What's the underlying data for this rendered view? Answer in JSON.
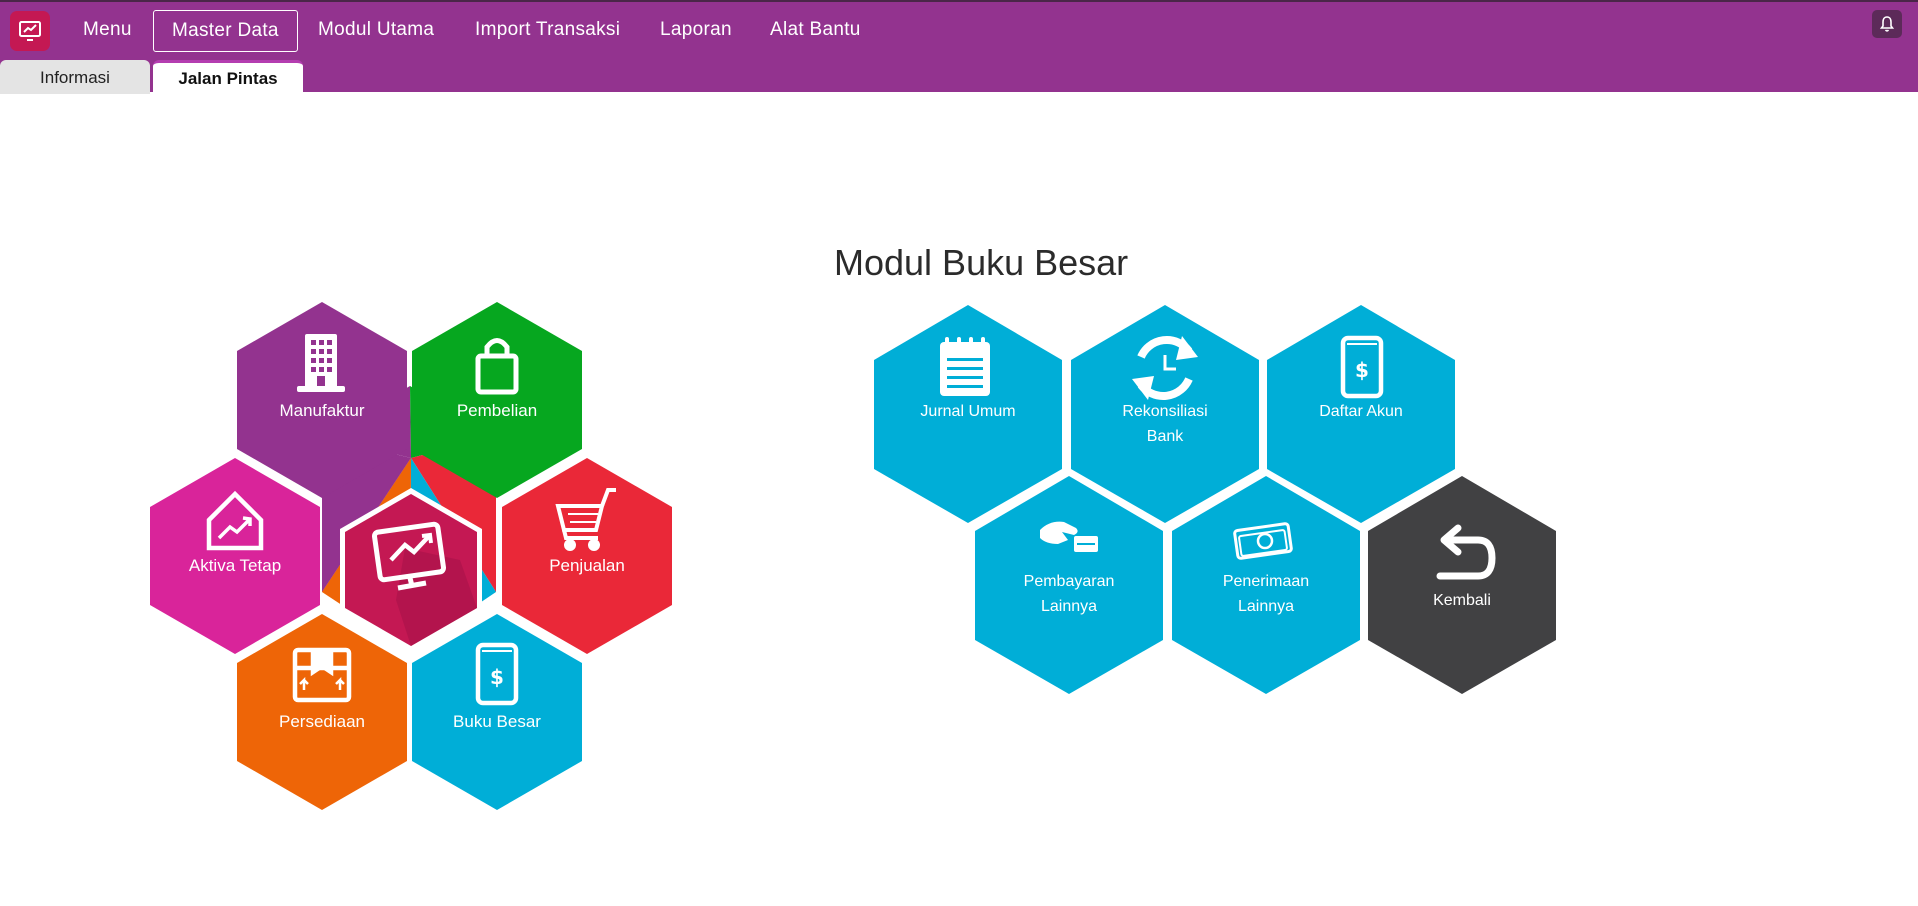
{
  "nav": {
    "items": [
      "Menu",
      "Master Data",
      "Modul Utama",
      "Import Transaksi",
      "Laporan",
      "Alat Bantu"
    ],
    "active": "Master Data"
  },
  "tabs": [
    "Informasi",
    "Jalan Pintas"
  ],
  "active_tab": "Jalan Pintas",
  "page_title": "Modul Buku Besar",
  "left_modules": {
    "manufaktur": {
      "label": "Manufaktur",
      "color": "#93338f",
      "icon": "building-icon"
    },
    "pembelian": {
      "label": "Pembelian",
      "color": "#06a71f",
      "icon": "shopping-bag-icon"
    },
    "aktiva": {
      "label": "Aktiva Tetap",
      "color": "#d9249a",
      "icon": "house-chart-icon"
    },
    "penjualan": {
      "label": "Penjualan",
      "color": "#ea2838",
      "icon": "cart-icon"
    },
    "persediaan": {
      "label": "Persediaan",
      "color": "#ee6507",
      "icon": "box-icon"
    },
    "buku_besar": {
      "label": "Buku Besar",
      "color": "#00aed7",
      "icon": "dollar-book-icon"
    },
    "center": {
      "color": "#c41853",
      "icon": "monitor-chart-icon"
    }
  },
  "right_modules": {
    "jurnal": {
      "label": "Jurnal Umum",
      "color": "#00aed7",
      "icon": "notepad-icon"
    },
    "rekon": {
      "label": "Rekonsiliasi",
      "label2": "Bank",
      "color": "#00aed7",
      "icon": "sync-clock-icon"
    },
    "daftar": {
      "label": "Daftar Akun",
      "color": "#00aed7",
      "icon": "dollar-book-icon"
    },
    "bayar": {
      "label": "Pembayaran",
      "label2": "Lainnya",
      "color": "#00aed7",
      "icon": "hand-card-icon"
    },
    "terima": {
      "label": "Penerimaan",
      "label2": "Lainnya",
      "color": "#00aed7",
      "icon": "cash-icon"
    },
    "kembali": {
      "label": "Kembali",
      "color": "#414143",
      "icon": "return-arrow-icon"
    }
  },
  "colors": {
    "topbar": "#93338f",
    "accent": "#c41853"
  }
}
